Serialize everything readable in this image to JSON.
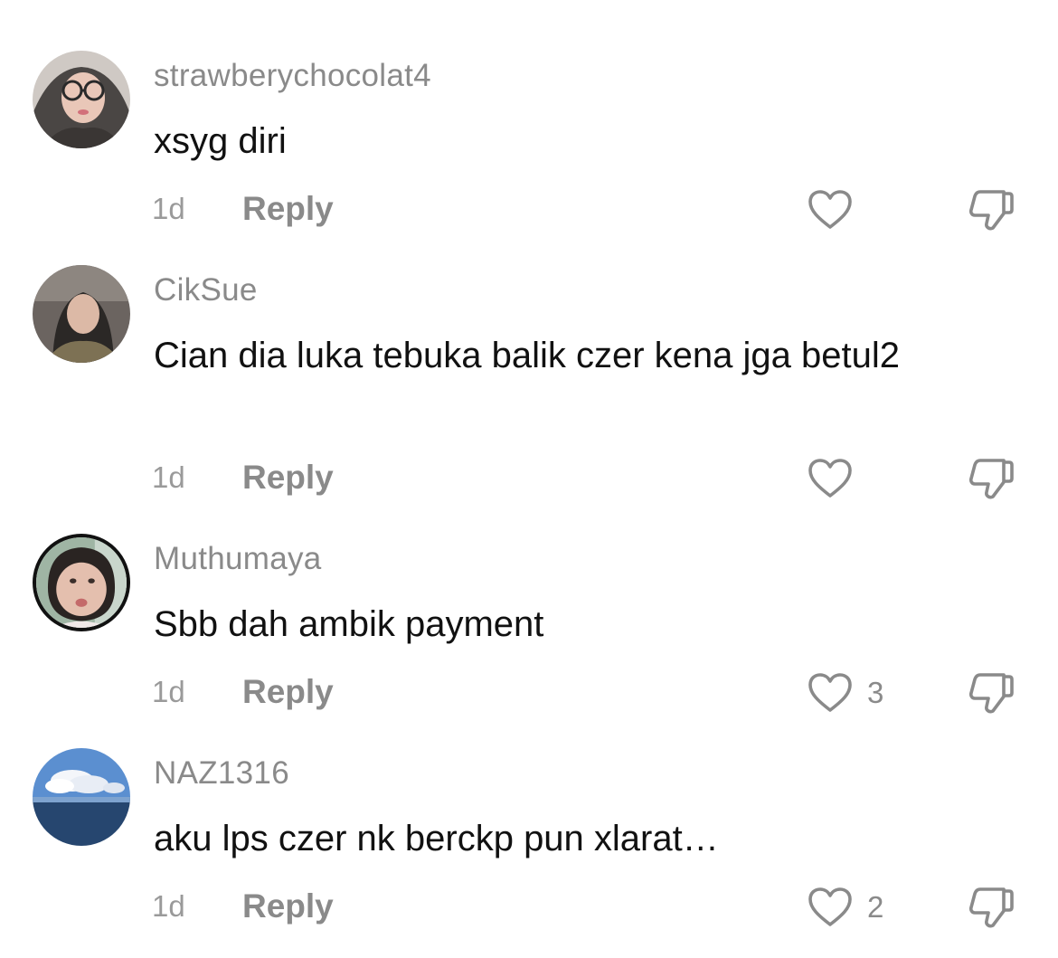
{
  "comments": [
    {
      "username": "strawberychocolat4",
      "text": "xsyg diri",
      "time": "1d",
      "reply_label": "Reply",
      "likes": ""
    },
    {
      "username": "CikSue",
      "text": "Cian dia luka tebuka balik czer kena jga betul2",
      "time": "1d",
      "reply_label": "Reply",
      "likes": ""
    },
    {
      "username": "Muthumaya",
      "text": "Sbb dah ambik payment",
      "time": "1d",
      "reply_label": "Reply",
      "likes": "3"
    },
    {
      "username": "NAZ1316",
      "text": "aku lps czer nk berckp pun xlarat…",
      "time": "1d",
      "reply_label": "Reply",
      "likes": "2"
    }
  ],
  "icons": {
    "like": "heart-outline-icon",
    "dislike": "thumbs-down-icon"
  },
  "colors": {
    "username": "#8a8a8a",
    "text": "#111111",
    "meta": "#9a9a9a",
    "icon_stroke": "#8a8a8a"
  }
}
